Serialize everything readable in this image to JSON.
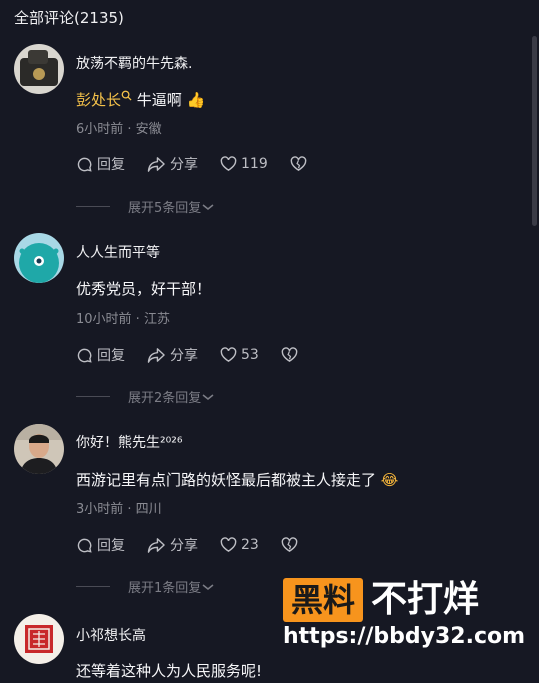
{
  "header": {
    "title": "全部评论(2135)"
  },
  "comments": [
    {
      "username": "放荡不羁的牛先森.",
      "mention": "彭处长",
      "text": "牛逼啊",
      "emoji": "👍",
      "meta": "6小时前 · 安徽",
      "reply_label": "回复",
      "share_label": "分享",
      "likes": "119",
      "expand_label": "展开5条回复"
    },
    {
      "username": "人人生而平等",
      "text": "优秀党员，好干部！",
      "meta": "10小时前 · 江苏",
      "reply_label": "回复",
      "share_label": "分享",
      "likes": "53",
      "expand_label": "展开2条回复"
    },
    {
      "username": "你好！熊先生²⁰²⁶",
      "text": "西游记里有点门路的妖怪最后都被主人接走了",
      "emoji": "😂",
      "meta": "3小时前 · 四川",
      "reply_label": "回复",
      "share_label": "分享",
      "likes": "23",
      "expand_label": "展开1条回复"
    },
    {
      "username": "小祁想长高",
      "text": "还等着这种人为人民服务呢!"
    }
  ],
  "watermark": {
    "box_text": "黑料",
    "text": "不打烊",
    "url": "https://bbdy32.com"
  },
  "colors": {
    "background": "#161823",
    "mention": "#f5c24a",
    "watermark_orange": "#f7941d"
  }
}
